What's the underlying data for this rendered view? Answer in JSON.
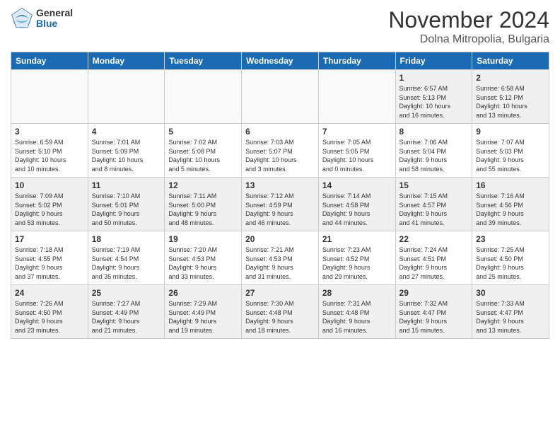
{
  "logo": {
    "general": "General",
    "blue": "Blue"
  },
  "title": "November 2024",
  "subtitle": "Dolna Mitropolia, Bulgaria",
  "days_header": [
    "Sunday",
    "Monday",
    "Tuesday",
    "Wednesday",
    "Thursday",
    "Friday",
    "Saturday"
  ],
  "weeks": [
    [
      {
        "day": "",
        "info": ""
      },
      {
        "day": "",
        "info": ""
      },
      {
        "day": "",
        "info": ""
      },
      {
        "day": "",
        "info": ""
      },
      {
        "day": "",
        "info": ""
      },
      {
        "day": "1",
        "info": "Sunrise: 6:57 AM\nSunset: 5:13 PM\nDaylight: 10 hours\nand 16 minutes."
      },
      {
        "day": "2",
        "info": "Sunrise: 6:58 AM\nSunset: 5:12 PM\nDaylight: 10 hours\nand 13 minutes."
      }
    ],
    [
      {
        "day": "3",
        "info": "Sunrise: 6:59 AM\nSunset: 5:10 PM\nDaylight: 10 hours\nand 10 minutes."
      },
      {
        "day": "4",
        "info": "Sunrise: 7:01 AM\nSunset: 5:09 PM\nDaylight: 10 hours\nand 8 minutes."
      },
      {
        "day": "5",
        "info": "Sunrise: 7:02 AM\nSunset: 5:08 PM\nDaylight: 10 hours\nand 5 minutes."
      },
      {
        "day": "6",
        "info": "Sunrise: 7:03 AM\nSunset: 5:07 PM\nDaylight: 10 hours\nand 3 minutes."
      },
      {
        "day": "7",
        "info": "Sunrise: 7:05 AM\nSunset: 5:05 PM\nDaylight: 10 hours\nand 0 minutes."
      },
      {
        "day": "8",
        "info": "Sunrise: 7:06 AM\nSunset: 5:04 PM\nDaylight: 9 hours\nand 58 minutes."
      },
      {
        "day": "9",
        "info": "Sunrise: 7:07 AM\nSunset: 5:03 PM\nDaylight: 9 hours\nand 55 minutes."
      }
    ],
    [
      {
        "day": "10",
        "info": "Sunrise: 7:09 AM\nSunset: 5:02 PM\nDaylight: 9 hours\nand 53 minutes."
      },
      {
        "day": "11",
        "info": "Sunrise: 7:10 AM\nSunset: 5:01 PM\nDaylight: 9 hours\nand 50 minutes."
      },
      {
        "day": "12",
        "info": "Sunrise: 7:11 AM\nSunset: 5:00 PM\nDaylight: 9 hours\nand 48 minutes."
      },
      {
        "day": "13",
        "info": "Sunrise: 7:12 AM\nSunset: 4:59 PM\nDaylight: 9 hours\nand 46 minutes."
      },
      {
        "day": "14",
        "info": "Sunrise: 7:14 AM\nSunset: 4:58 PM\nDaylight: 9 hours\nand 44 minutes."
      },
      {
        "day": "15",
        "info": "Sunrise: 7:15 AM\nSunset: 4:57 PM\nDaylight: 9 hours\nand 41 minutes."
      },
      {
        "day": "16",
        "info": "Sunrise: 7:16 AM\nSunset: 4:56 PM\nDaylight: 9 hours\nand 39 minutes."
      }
    ],
    [
      {
        "day": "17",
        "info": "Sunrise: 7:18 AM\nSunset: 4:55 PM\nDaylight: 9 hours\nand 37 minutes."
      },
      {
        "day": "18",
        "info": "Sunrise: 7:19 AM\nSunset: 4:54 PM\nDaylight: 9 hours\nand 35 minutes."
      },
      {
        "day": "19",
        "info": "Sunrise: 7:20 AM\nSunset: 4:53 PM\nDaylight: 9 hours\nand 33 minutes."
      },
      {
        "day": "20",
        "info": "Sunrise: 7:21 AM\nSunset: 4:53 PM\nDaylight: 9 hours\nand 31 minutes."
      },
      {
        "day": "21",
        "info": "Sunrise: 7:23 AM\nSunset: 4:52 PM\nDaylight: 9 hours\nand 29 minutes."
      },
      {
        "day": "22",
        "info": "Sunrise: 7:24 AM\nSunset: 4:51 PM\nDaylight: 9 hours\nand 27 minutes."
      },
      {
        "day": "23",
        "info": "Sunrise: 7:25 AM\nSunset: 4:50 PM\nDaylight: 9 hours\nand 25 minutes."
      }
    ],
    [
      {
        "day": "24",
        "info": "Sunrise: 7:26 AM\nSunset: 4:50 PM\nDaylight: 9 hours\nand 23 minutes."
      },
      {
        "day": "25",
        "info": "Sunrise: 7:27 AM\nSunset: 4:49 PM\nDaylight: 9 hours\nand 21 minutes."
      },
      {
        "day": "26",
        "info": "Sunrise: 7:29 AM\nSunset: 4:49 PM\nDaylight: 9 hours\nand 19 minutes."
      },
      {
        "day": "27",
        "info": "Sunrise: 7:30 AM\nSunset: 4:48 PM\nDaylight: 9 hours\nand 18 minutes."
      },
      {
        "day": "28",
        "info": "Sunrise: 7:31 AM\nSunset: 4:48 PM\nDaylight: 9 hours\nand 16 minutes."
      },
      {
        "day": "29",
        "info": "Sunrise: 7:32 AM\nSunset: 4:47 PM\nDaylight: 9 hours\nand 15 minutes."
      },
      {
        "day": "30",
        "info": "Sunrise: 7:33 AM\nSunset: 4:47 PM\nDaylight: 9 hours\nand 13 minutes."
      }
    ]
  ]
}
